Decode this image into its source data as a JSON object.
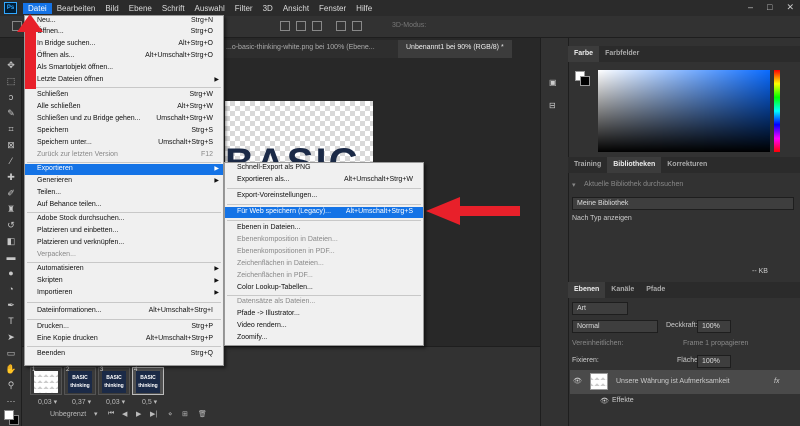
{
  "menubar": {
    "logo": "Ps",
    "items": [
      "Datei",
      "Bearbeiten",
      "Bild",
      "Ebene",
      "Schrift",
      "Auswahl",
      "Filter",
      "3D",
      "Ansicht",
      "Fenster",
      "Hilfe"
    ],
    "window_controls": [
      "–",
      "□",
      "✕"
    ]
  },
  "optionsbar": {
    "mode_3d": "3D-Modus:"
  },
  "doc_tabs": [
    {
      "label": "...o-basic-thinking-white.png bei 100% (Ebene...",
      "active": false
    },
    {
      "label": "Unbenannt1 bei 90% (RGB/8) *",
      "active": true
    }
  ],
  "canvas": {
    "doc_text": "BASIC"
  },
  "menu_datei": {
    "items": [
      {
        "label": "Neu...",
        "shortcut": "Strg+N"
      },
      {
        "label": "Öffnen...",
        "shortcut": "Strg+O"
      },
      {
        "label": "In Bridge suchen...",
        "shortcut": "Alt+Strg+O"
      },
      {
        "label": "Öffnen als...",
        "shortcut": "Alt+Umschalt+Strg+O"
      },
      {
        "label": "Als Smartobjekt öffnen...",
        "shortcut": ""
      },
      {
        "label": "Letzte Dateien öffnen",
        "shortcut": "",
        "submenu": true
      },
      {
        "label": "Schließen",
        "shortcut": "Strg+W"
      },
      {
        "label": "Alle schließen",
        "shortcut": "Alt+Strg+W"
      },
      {
        "label": "Schließen und zu Bridge gehen...",
        "shortcut": "Umschalt+Strg+W"
      },
      {
        "label": "Speichern",
        "shortcut": "Strg+S"
      },
      {
        "label": "Speichern unter...",
        "shortcut": "Umschalt+Strg+S"
      },
      {
        "label": "Zurück zur letzten Version",
        "shortcut": "F12",
        "disabled": true
      },
      {
        "label": "Exportieren",
        "shortcut": "",
        "submenu": true,
        "highlighted": true
      },
      {
        "label": "Generieren",
        "shortcut": "",
        "submenu": true
      },
      {
        "label": "Teilen...",
        "shortcut": ""
      },
      {
        "label": "Auf Behance teilen...",
        "shortcut": ""
      },
      {
        "label": "Adobe Stock durchsuchen...",
        "shortcut": ""
      },
      {
        "label": "Platzieren und einbetten...",
        "shortcut": ""
      },
      {
        "label": "Platzieren und verknüpfen...",
        "shortcut": ""
      },
      {
        "label": "Verpacken...",
        "shortcut": "",
        "disabled": true
      },
      {
        "label": "Automatisieren",
        "shortcut": "",
        "submenu": true
      },
      {
        "label": "Skripten",
        "shortcut": "",
        "submenu": true
      },
      {
        "label": "Importieren",
        "shortcut": "",
        "submenu": true
      },
      {
        "label": "Dateiinformationen...",
        "shortcut": "Alt+Umschalt+Strg+I"
      },
      {
        "label": "Drucken...",
        "shortcut": "Strg+P"
      },
      {
        "label": "Eine Kopie drucken",
        "shortcut": "Alt+Umschalt+Strg+P"
      },
      {
        "label": "Beenden",
        "shortcut": "Strg+Q"
      }
    ]
  },
  "menu_export": {
    "items": [
      {
        "label": "Schnell-Export als PNG",
        "shortcut": ""
      },
      {
        "label": "Exportieren als...",
        "shortcut": "Alt+Umschalt+Strg+W"
      },
      {
        "label": "Export-Voreinstellungen...",
        "shortcut": ""
      },
      {
        "label": "Für Web speichern (Legacy)...",
        "shortcut": "Alt+Umschalt+Strg+S",
        "highlighted": true
      },
      {
        "label": "Ebenen in Dateien...",
        "shortcut": ""
      },
      {
        "label": "Ebenenkomposition in Dateien...",
        "shortcut": "",
        "disabled": true
      },
      {
        "label": "Ebenenkompositionen in PDF...",
        "shortcut": "",
        "disabled": true
      },
      {
        "label": "Zeichenflächen in Dateien...",
        "shortcut": "",
        "disabled": true
      },
      {
        "label": "Zeichenflächen in PDF...",
        "shortcut": "",
        "disabled": true
      },
      {
        "label": "Color Lookup-Tabellen...",
        "shortcut": ""
      },
      {
        "label": "Datensätze als Dateien...",
        "shortcut": "",
        "disabled": true
      },
      {
        "label": "Pfade -> Illustrator...",
        "shortcut": ""
      },
      {
        "label": "Video rendern...",
        "shortcut": ""
      },
      {
        "label": "Zoomify...",
        "shortcut": ""
      }
    ]
  },
  "timeline": {
    "frames": [
      {
        "num": "1",
        "duration": "0,03 ▾",
        "thumb": ""
      },
      {
        "num": "2",
        "duration": "0,37 ▾",
        "thumb": "BASIC thinking"
      },
      {
        "num": "3",
        "duration": "0,03 ▾",
        "thumb": "BASIC thinking"
      },
      {
        "num": "4",
        "duration": "0,5 ▾",
        "thumb": "BASIC thinking"
      }
    ],
    "loop": "Unbegrenzt"
  },
  "color_panel": {
    "tabs": [
      "Farbe",
      "Farbfelder"
    ]
  },
  "library_panel": {
    "tabs": [
      "Training",
      "Bibliotheken",
      "Korrekturen"
    ],
    "search_placeholder": "Aktuelle Bibliothek durchsuchen",
    "library": "Meine Bibliothek",
    "sort": "Nach Typ anzeigen",
    "size": "-- KB"
  },
  "layers_panel": {
    "tabs": [
      "Ebenen",
      "Kanäle",
      "Pfade"
    ],
    "filter": "Art",
    "blend_mode": "Normal",
    "opacity_label": "Deckkraft:",
    "opacity": "100%",
    "unify_label": "Vereinheitlichen:",
    "propagate": "Frame 1 propagieren",
    "lock_label": "Fixieren:",
    "fill_label": "Fläche:",
    "fill": "100%",
    "layer_name": "Unsere Währung ist Aufmerksamkeit",
    "fx": "fx",
    "effects": "Effekte"
  },
  "colors": {
    "accent": "#1473e6",
    "arrow": "#e8202a",
    "brand_navy": "#1b2a47"
  }
}
